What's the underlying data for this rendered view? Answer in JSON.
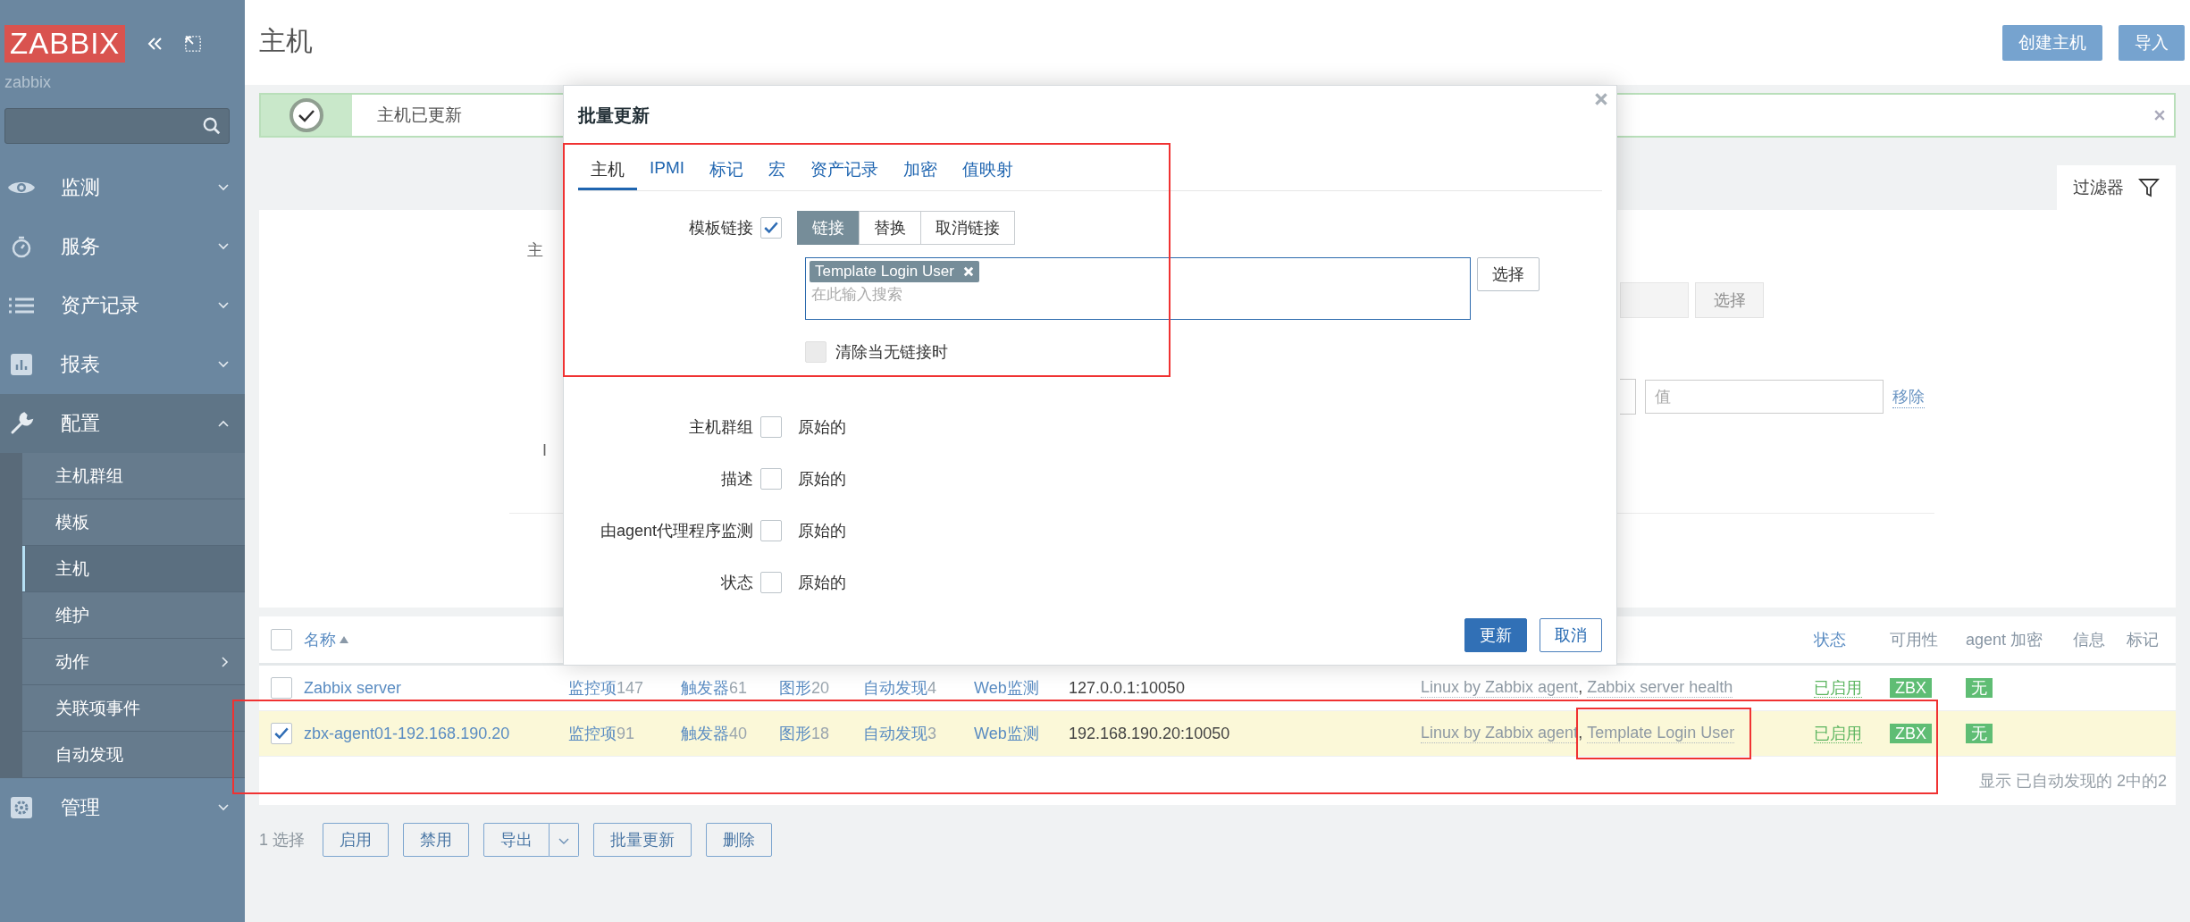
{
  "sidebar": {
    "logo": "ZABBIX",
    "server": "zabbix",
    "menu": [
      {
        "label": "监测",
        "expanded": false
      },
      {
        "label": "服务",
        "expanded": false
      },
      {
        "label": "资产记录",
        "expanded": false
      },
      {
        "label": "报表",
        "expanded": false
      },
      {
        "label": "配置",
        "expanded": true,
        "children": [
          {
            "label": "主机群组",
            "selected": false,
            "submenu": false
          },
          {
            "label": "模板",
            "selected": false,
            "submenu": false
          },
          {
            "label": "主机",
            "selected": true,
            "submenu": false
          },
          {
            "label": "维护",
            "selected": false,
            "submenu": false
          },
          {
            "label": "动作",
            "selected": false,
            "submenu": true
          },
          {
            "label": "关联项事件",
            "selected": false,
            "submenu": false
          },
          {
            "label": "自动发现",
            "selected": false,
            "submenu": false
          }
        ]
      },
      {
        "label": "管理",
        "expanded": false
      }
    ]
  },
  "header": {
    "title": "主机",
    "buttons": [
      "创建主机",
      "导入"
    ]
  },
  "message": {
    "kind": "success",
    "text": "主机已更新"
  },
  "filter": {
    "tab": "过滤器",
    "label_1": "主",
    "label_2": "I",
    "select_button": "选择",
    "value_placeholder": "值",
    "remove_link": "移除"
  },
  "table": {
    "all_selected": false,
    "columns": [
      {
        "label": "名称",
        "sortable": true,
        "sorted": true
      },
      {
        "label": "状态",
        "sortable": true,
        "sorted": false
      },
      {
        "label": "可用性",
        "sortable": false,
        "sorted": false
      },
      {
        "label": "agent 加密",
        "sortable": false,
        "sorted": false
      },
      {
        "label": "信息",
        "sortable": false,
        "sorted": false
      },
      {
        "label": "标记",
        "sortable": false,
        "sorted": false
      }
    ],
    "template_separator": ",",
    "rows": [
      {
        "selected": false,
        "name": "Zabbix server",
        "links": [
          {
            "label": "监控项",
            "count": "147"
          },
          {
            "label": "触发器",
            "count": "61"
          },
          {
            "label": "图形",
            "count": "20"
          },
          {
            "label": "自动发现",
            "count": "4"
          },
          {
            "label": "Web监测"
          }
        ],
        "interface": "127.0.0.1:10050",
        "templates": [
          "Linux by Zabbix agent",
          "Zabbix server health"
        ],
        "status": "已启用",
        "availability": "ZBX",
        "encryption": "无"
      },
      {
        "selected": true,
        "name": "zbx-agent01-192.168.190.20",
        "links": [
          {
            "label": "监控项",
            "count": "91"
          },
          {
            "label": "触发器",
            "count": "40"
          },
          {
            "label": "图形",
            "count": "18"
          },
          {
            "label": "自动发现",
            "count": "3"
          },
          {
            "label": "Web监测"
          }
        ],
        "interface": "192.168.190.20:10050",
        "templates": [
          "Linux by Zabbix agent",
          "Template Login User"
        ],
        "status": "已启用",
        "availability": "ZBX",
        "encryption": "无"
      }
    ],
    "footer": "显示 已自动发现的 2中的2"
  },
  "actions": {
    "selected_count": "1 选择",
    "buttons": [
      {
        "label": "启用",
        "dropdown": false
      },
      {
        "label": "禁用",
        "dropdown": false
      },
      {
        "label": "导出",
        "dropdown": true
      },
      {
        "label": "批量更新",
        "dropdown": false
      },
      {
        "label": "删除",
        "dropdown": false
      }
    ]
  },
  "modal": {
    "title": "批量更新",
    "tabs": [
      {
        "label": "主机",
        "selected": true
      },
      {
        "label": "IPMI",
        "selected": false
      },
      {
        "label": "标记",
        "selected": false
      },
      {
        "label": "宏",
        "selected": false
      },
      {
        "label": "资产记录",
        "selected": false
      },
      {
        "label": "加密",
        "selected": false
      },
      {
        "label": "值映射",
        "selected": false
      }
    ],
    "template_link": {
      "label": "模板链接",
      "checked": true,
      "modes": [
        {
          "label": "链接",
          "selected": true
        },
        {
          "label": "替换",
          "selected": false
        },
        {
          "label": "取消链接",
          "selected": false
        }
      ],
      "chips": [
        "Template Login User"
      ],
      "placeholder": "在此输入搜索",
      "select_button": "选择",
      "clear": {
        "label": "清除当无链接时",
        "checked": false,
        "disabled": true
      }
    },
    "fields": [
      {
        "label": "主机群组",
        "checked": false,
        "value": "原始的"
      },
      {
        "label": "描述",
        "checked": false,
        "value": "原始的"
      },
      {
        "label": "由agent代理程序监测",
        "checked": false,
        "value": "原始的"
      },
      {
        "label": "状态",
        "checked": false,
        "value": "原始的"
      }
    ],
    "buttons": [
      {
        "label": "更新",
        "kind": "primary"
      },
      {
        "label": "取消",
        "kind": "secondary"
      }
    ]
  }
}
